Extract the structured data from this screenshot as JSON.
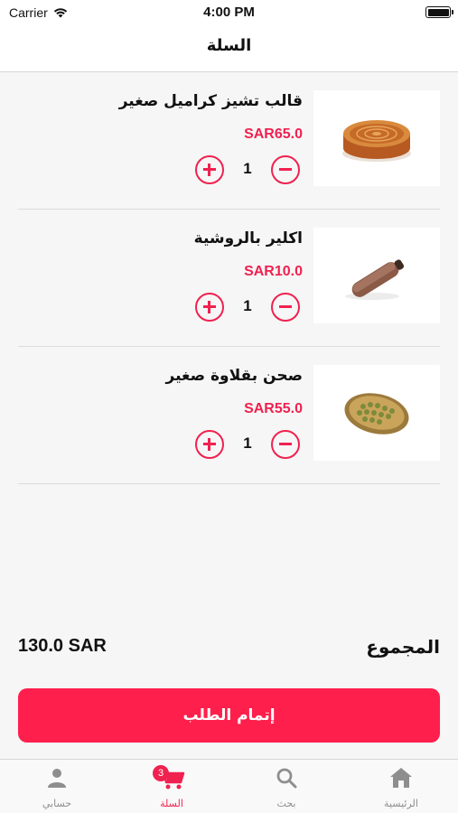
{
  "status_bar": {
    "carrier": "Carrier",
    "time": "4:00 PM"
  },
  "nav": {
    "title": "السلة"
  },
  "cart": {
    "items": [
      {
        "name": "قالب تشيز كراميل صغير",
        "price": "SAR65.0",
        "quantity": "1",
        "image_icon": "caramel-cheesecake-image"
      },
      {
        "name": "اكلير بالروشية",
        "price": "SAR10.0",
        "quantity": "1",
        "image_icon": "eclair-image"
      },
      {
        "name": "صحن بقلاوة صغير",
        "price": "SAR55.0",
        "quantity": "1",
        "image_icon": "baklava-plate-image"
      }
    ]
  },
  "summary": {
    "total_label": "المجموع",
    "total_value": "130.0 SAR"
  },
  "checkout": {
    "label": "إتمام الطلب"
  },
  "tab_bar": {
    "tabs": [
      {
        "label": "حسابي",
        "icon": "person-icon"
      },
      {
        "label": "السلة",
        "icon": "cart-icon",
        "badge": "3"
      },
      {
        "label": "بحث",
        "icon": "search-icon"
      },
      {
        "label": "الرئيسية",
        "icon": "home-icon"
      }
    ]
  },
  "colors": {
    "accent": "#f0214f",
    "button": "#ff1f4c",
    "inactive": "#8e8e8e"
  }
}
